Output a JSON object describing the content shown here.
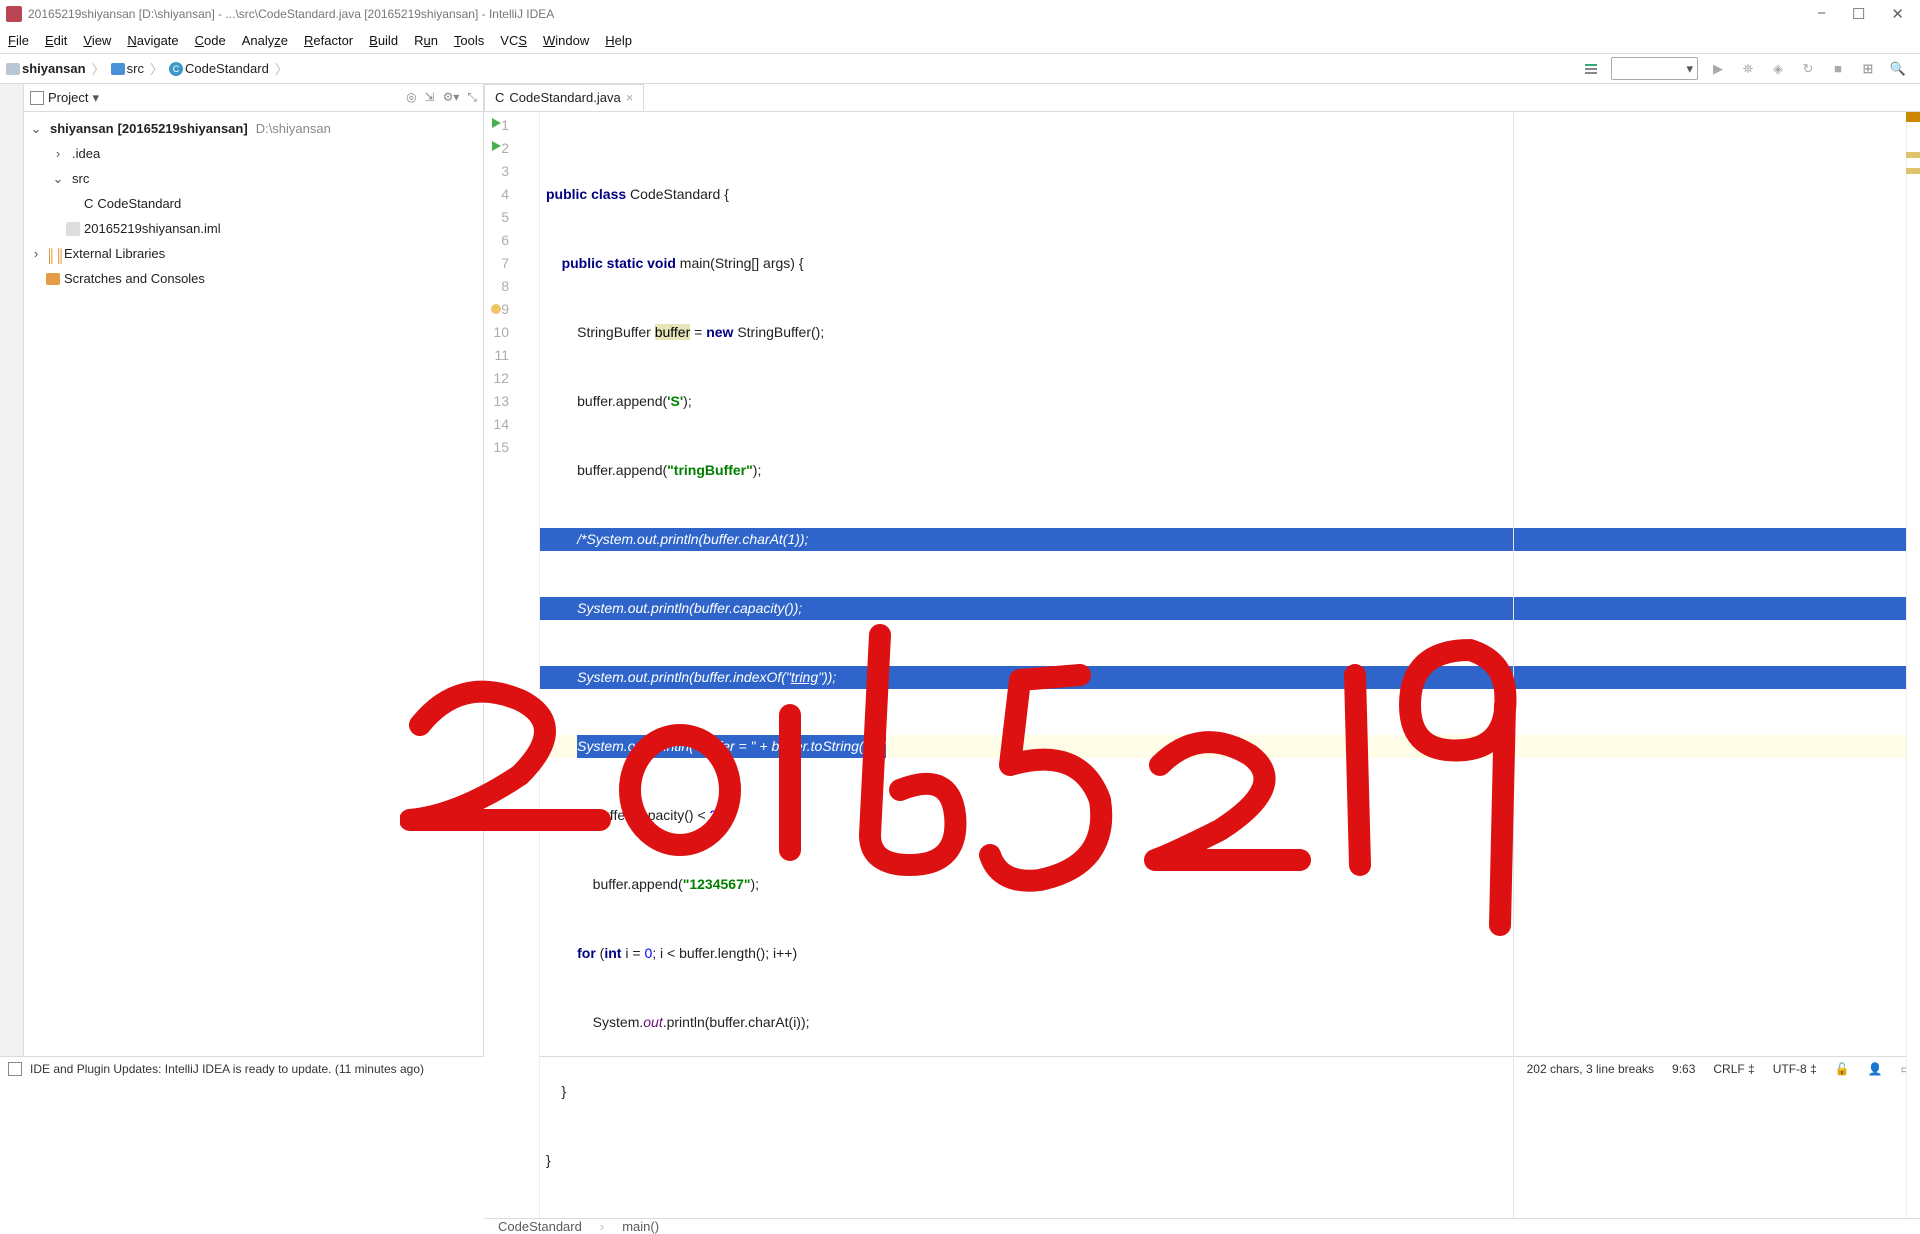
{
  "window": {
    "title": "20165219shiyansan [D:\\shiyansan] - ...\\src\\CodeStandard.java [20165219shiyansan] - IntelliJ IDEA"
  },
  "menu": {
    "file": "File",
    "edit": "Edit",
    "view": "View",
    "navigate": "Navigate",
    "code": "Code",
    "analyze": "Analyze",
    "refactor": "Refactor",
    "build": "Build",
    "run": "Run",
    "tools": "Tools",
    "vcs": "VCS",
    "window": "Window",
    "help": "Help"
  },
  "breadcrumb": {
    "root": "shiyansan",
    "src": "src",
    "cls": "CodeStandard"
  },
  "project": {
    "title": "Project",
    "root": "shiyansan",
    "root_mod": "[20165219shiyansan]",
    "root_path": "D:\\shiyansan",
    "idea": ".idea",
    "src": "src",
    "file_class": "CodeStandard",
    "iml": "20165219shiyansan.iml",
    "ext": "External Libraries",
    "scratch": "Scratches and Consoles"
  },
  "tab": {
    "name": "CodeStandard.java"
  },
  "code": {
    "lines": [
      "1",
      "2",
      "3",
      "4",
      "5",
      "6",
      "7",
      "8",
      "9",
      "10",
      "11",
      "12",
      "13",
      "14",
      "15"
    ]
  },
  "breadcrumb_footer": {
    "cls": "CodeStandard",
    "m": "main()"
  },
  "status": {
    "msg": "IDE and Plugin Updates: IntelliJ IDEA is ready to update. (11 minutes ago)",
    "counts": "202 chars, 3 line breaks",
    "pos": "9:63",
    "eol": "CRLF",
    "enc": "UTF-8"
  },
  "handwriting": "20165219"
}
